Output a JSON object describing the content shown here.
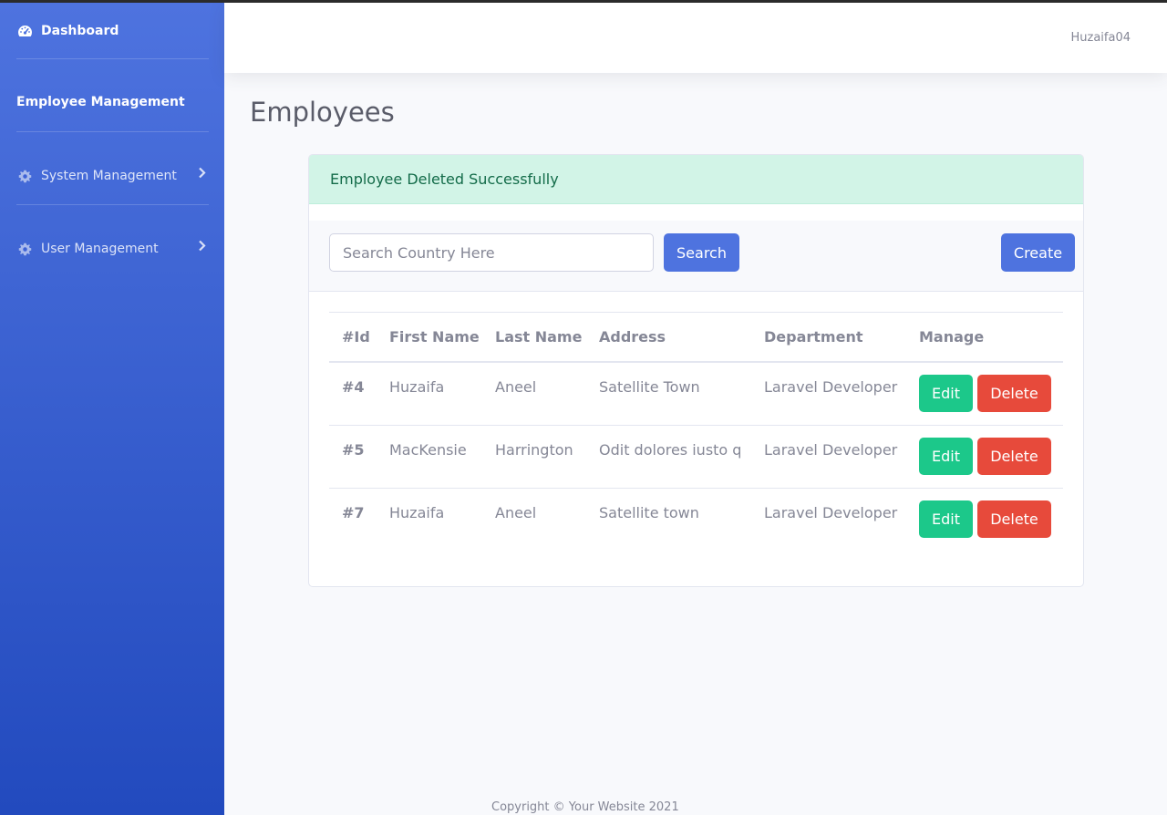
{
  "sidebar": {
    "dashboard": "Dashboard",
    "employee_management": "Employee Management",
    "system_management": "System Management",
    "user_management": "User Management"
  },
  "topbar": {
    "username": "Huzaifa04"
  },
  "page": {
    "title": "Employees"
  },
  "alert": {
    "message": "Employee Deleted Successfully"
  },
  "toolbar": {
    "search_placeholder": "Search Country Here",
    "search_value": "",
    "search_label": "Search",
    "create_label": "Create"
  },
  "table": {
    "columns": [
      "#Id",
      "First Name",
      "Last Name",
      "Address",
      "Department",
      "Manage"
    ],
    "rows": [
      {
        "id": "#4",
        "first": "Huzaifa",
        "last": "Aneel",
        "address": "Satellite Town",
        "department": "Laravel Developer",
        "edit": "Edit",
        "delete": "Delete"
      },
      {
        "id": "#5",
        "first": "MacKensie",
        "last": "Harrington",
        "address": "Odit dolores iusto q",
        "department": "Laravel Developer",
        "edit": "Edit",
        "delete": "Delete"
      },
      {
        "id": "#7",
        "first": "Huzaifa",
        "last": "Aneel",
        "address": "Satellite town",
        "department": "Laravel Developer",
        "edit": "Edit",
        "delete": "Delete"
      }
    ]
  },
  "footer": {
    "text": "Copyright © Your Website 2021"
  },
  "icons": {
    "dashboard": "tachometer-icon",
    "system": "gear-icon",
    "user": "gear-icon",
    "chevron": "chevron-right-icon"
  },
  "colors": {
    "sidebar_top": "#4e73df",
    "sidebar_bottom": "#224abe",
    "primary": "#4e73df",
    "success": "#1cc88a",
    "danger": "#e74a3b",
    "alert_bg": "#d2f4e7"
  }
}
